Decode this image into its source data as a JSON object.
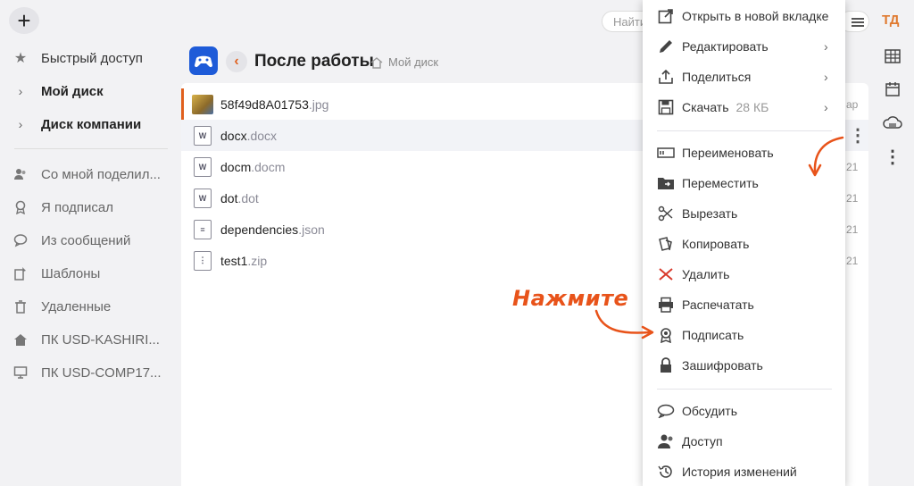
{
  "topbar": {
    "search_placeholder": "Найти",
    "avatar_initials": "ТД"
  },
  "sidebar": {
    "items": [
      {
        "label": "Быстрый доступ",
        "icon": "star-icon"
      },
      {
        "label": "Мой диск",
        "icon": "chevron-right-icon"
      },
      {
        "label": "Диск компании",
        "icon": "chevron-right-icon"
      },
      {
        "label": "Со мной поделил...",
        "icon": "shared-users-icon"
      },
      {
        "label": "Я подписал",
        "icon": "signature-badge-icon"
      },
      {
        "label": "Из сообщений",
        "icon": "chat-icon"
      },
      {
        "label": "Шаблоны",
        "icon": "template-icon"
      },
      {
        "label": "Удаленные",
        "icon": "trash-icon"
      },
      {
        "label": "ПК USD-KASHIRI...",
        "icon": "home-icon"
      },
      {
        "label": "ПК USD-COMP17...",
        "icon": "monitor-icon"
      }
    ]
  },
  "header": {
    "title": "После работы",
    "breadcrumb": "Мой диск"
  },
  "files": [
    {
      "name": "58f49d8A01753",
      "ext": ".jpg",
      "date": "ар"
    },
    {
      "name": "docx",
      "ext": ".docx",
      "date": ""
    },
    {
      "name": "docm",
      "ext": ".docm",
      "date": "21"
    },
    {
      "name": "dot",
      "ext": ".dot",
      "date": "21"
    },
    {
      "name": "dependencies",
      "ext": ".json",
      "date": "21"
    },
    {
      "name": "test1",
      "ext": ".zip",
      "date": "21"
    }
  ],
  "context_menu": {
    "items": [
      {
        "label": "Открыть в новой вкладке",
        "icon": "open-new-tab-icon"
      },
      {
        "label": "Редактировать",
        "icon": "pencil-icon",
        "submenu": true
      },
      {
        "label": "Поделиться",
        "icon": "share-upload-icon",
        "submenu": true
      },
      {
        "label": "Скачать",
        "icon": "save-disk-icon",
        "sub": "28 КБ",
        "submenu": true
      },
      {
        "label": "Переименовать",
        "icon": "rename-icon"
      },
      {
        "label": "Переместить",
        "icon": "move-folder-icon"
      },
      {
        "label": "Вырезать",
        "icon": "scissors-icon"
      },
      {
        "label": "Копировать",
        "icon": "copy-icon"
      },
      {
        "label": "Удалить",
        "icon": "delete-x-icon"
      },
      {
        "label": "Распечатать",
        "icon": "printer-icon"
      },
      {
        "label": "Подписать",
        "icon": "sign-badge-icon"
      },
      {
        "label": "Зашифровать",
        "icon": "lock-icon"
      },
      {
        "label": "Обсудить",
        "icon": "discuss-icon"
      },
      {
        "label": "Доступ",
        "icon": "access-users-icon"
      },
      {
        "label": "История изменений",
        "icon": "history-icon"
      }
    ]
  },
  "annotation": {
    "text": "Нажмите",
    "color": "#e8531a"
  },
  "colors": {
    "accent": "#e0601e",
    "logo_blue": "#1e5bd8"
  }
}
